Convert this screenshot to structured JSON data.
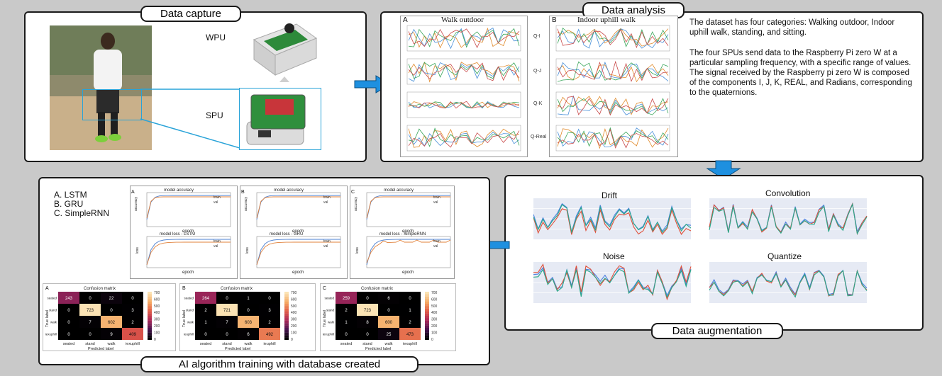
{
  "panels": {
    "capture": {
      "title": "Data capture",
      "wpu": "WPU",
      "spu": "SPU"
    },
    "analysis": {
      "title": "Data analysis",
      "sub_a": "A",
      "sub_a_title": "Walk outdoor",
      "sub_b": "B",
      "sub_b_title": "Indoor uphill walk",
      "q_labels": [
        "Q-I",
        "Q-J",
        "Q-K",
        "Q-Real"
      ],
      "desc1": "The dataset has four categories: Walking outdoor, Indoor uphill walk, standing, and sitting.",
      "desc2": "The four SPUs send data to the Raspberry Pi zero W at a particular sampling frequency, with a specific range of values. The signal received by the Raspberry pi zero W is composed of the components I, J, K, REAL, and Radians, corresponding to the quaternions."
    },
    "augmentation": {
      "title": "Data augmentation",
      "plots": [
        "Drift",
        "Convolution",
        "Noise",
        "Quantize"
      ]
    },
    "training": {
      "title": "AI algorithm training with database created",
      "models": [
        "A. LSTM",
        "B. GRU",
        "C. SimpleRNN"
      ],
      "acc_title": "model accuracy",
      "loss_titles": [
        "model loss - LSTM",
        "model loss - GRU",
        "model loss - SimpleRNN"
      ],
      "panel_letters": [
        "A",
        "B",
        "C"
      ],
      "epoch": "epoch",
      "acc_axis": "accuracy",
      "loss_axis": "loss",
      "legend": [
        "train",
        "val"
      ],
      "cm_title": "Confusion matrix",
      "cm_xlabel": "Predicted label",
      "cm_ylabel": "True label",
      "cm_classes": [
        "seated",
        "stand",
        "walk",
        "iexuphill"
      ]
    }
  },
  "chart_data": [
    {
      "type": "heatmap",
      "title": "Confusion matrix",
      "panel": "A",
      "xlabel": "Predicted label",
      "ylabel": "True label",
      "x": [
        "seated",
        "stand",
        "walk",
        "iexuphill"
      ],
      "y": [
        "seated",
        "stand",
        "walk",
        "iexuphill"
      ],
      "values": [
        [
          243,
          0,
          22,
          0
        ],
        [
          0,
          723,
          0,
          3
        ],
        [
          0,
          7,
          602,
          2
        ],
        [
          0,
          0,
          9,
          409
        ]
      ]
    },
    {
      "type": "heatmap",
      "title": "Confusion matrix",
      "panel": "B",
      "xlabel": "Predicted label",
      "ylabel": "True label",
      "x": [
        "seated",
        "stand",
        "walk",
        "ieuphill"
      ],
      "y": [
        "seated",
        "stand",
        "walk",
        "ieuphill"
      ],
      "values": [
        [
          264,
          0,
          1,
          0
        ],
        [
          2,
          721,
          0,
          3
        ],
        [
          1,
          7,
          603,
          2
        ],
        [
          0,
          0,
          6,
          492
        ]
      ]
    },
    {
      "type": "heatmap",
      "title": "Confusion matrix",
      "panel": "C",
      "xlabel": "Predicted label",
      "ylabel": "True label",
      "x": [
        "seated",
        "stand",
        "walk",
        "iexuphill"
      ],
      "y": [
        "seated",
        "stand",
        "walk",
        "iexuphill"
      ],
      "values": [
        [
          259,
          0,
          6,
          0
        ],
        [
          2,
          723,
          0,
          1
        ],
        [
          1,
          8,
          600,
          2
        ],
        [
          0,
          0,
          25,
          473
        ]
      ]
    }
  ],
  "colors": {
    "accent_arrow": "#1e90e0",
    "heat_low": "#000000",
    "heat_high": "#fbe3b4"
  }
}
